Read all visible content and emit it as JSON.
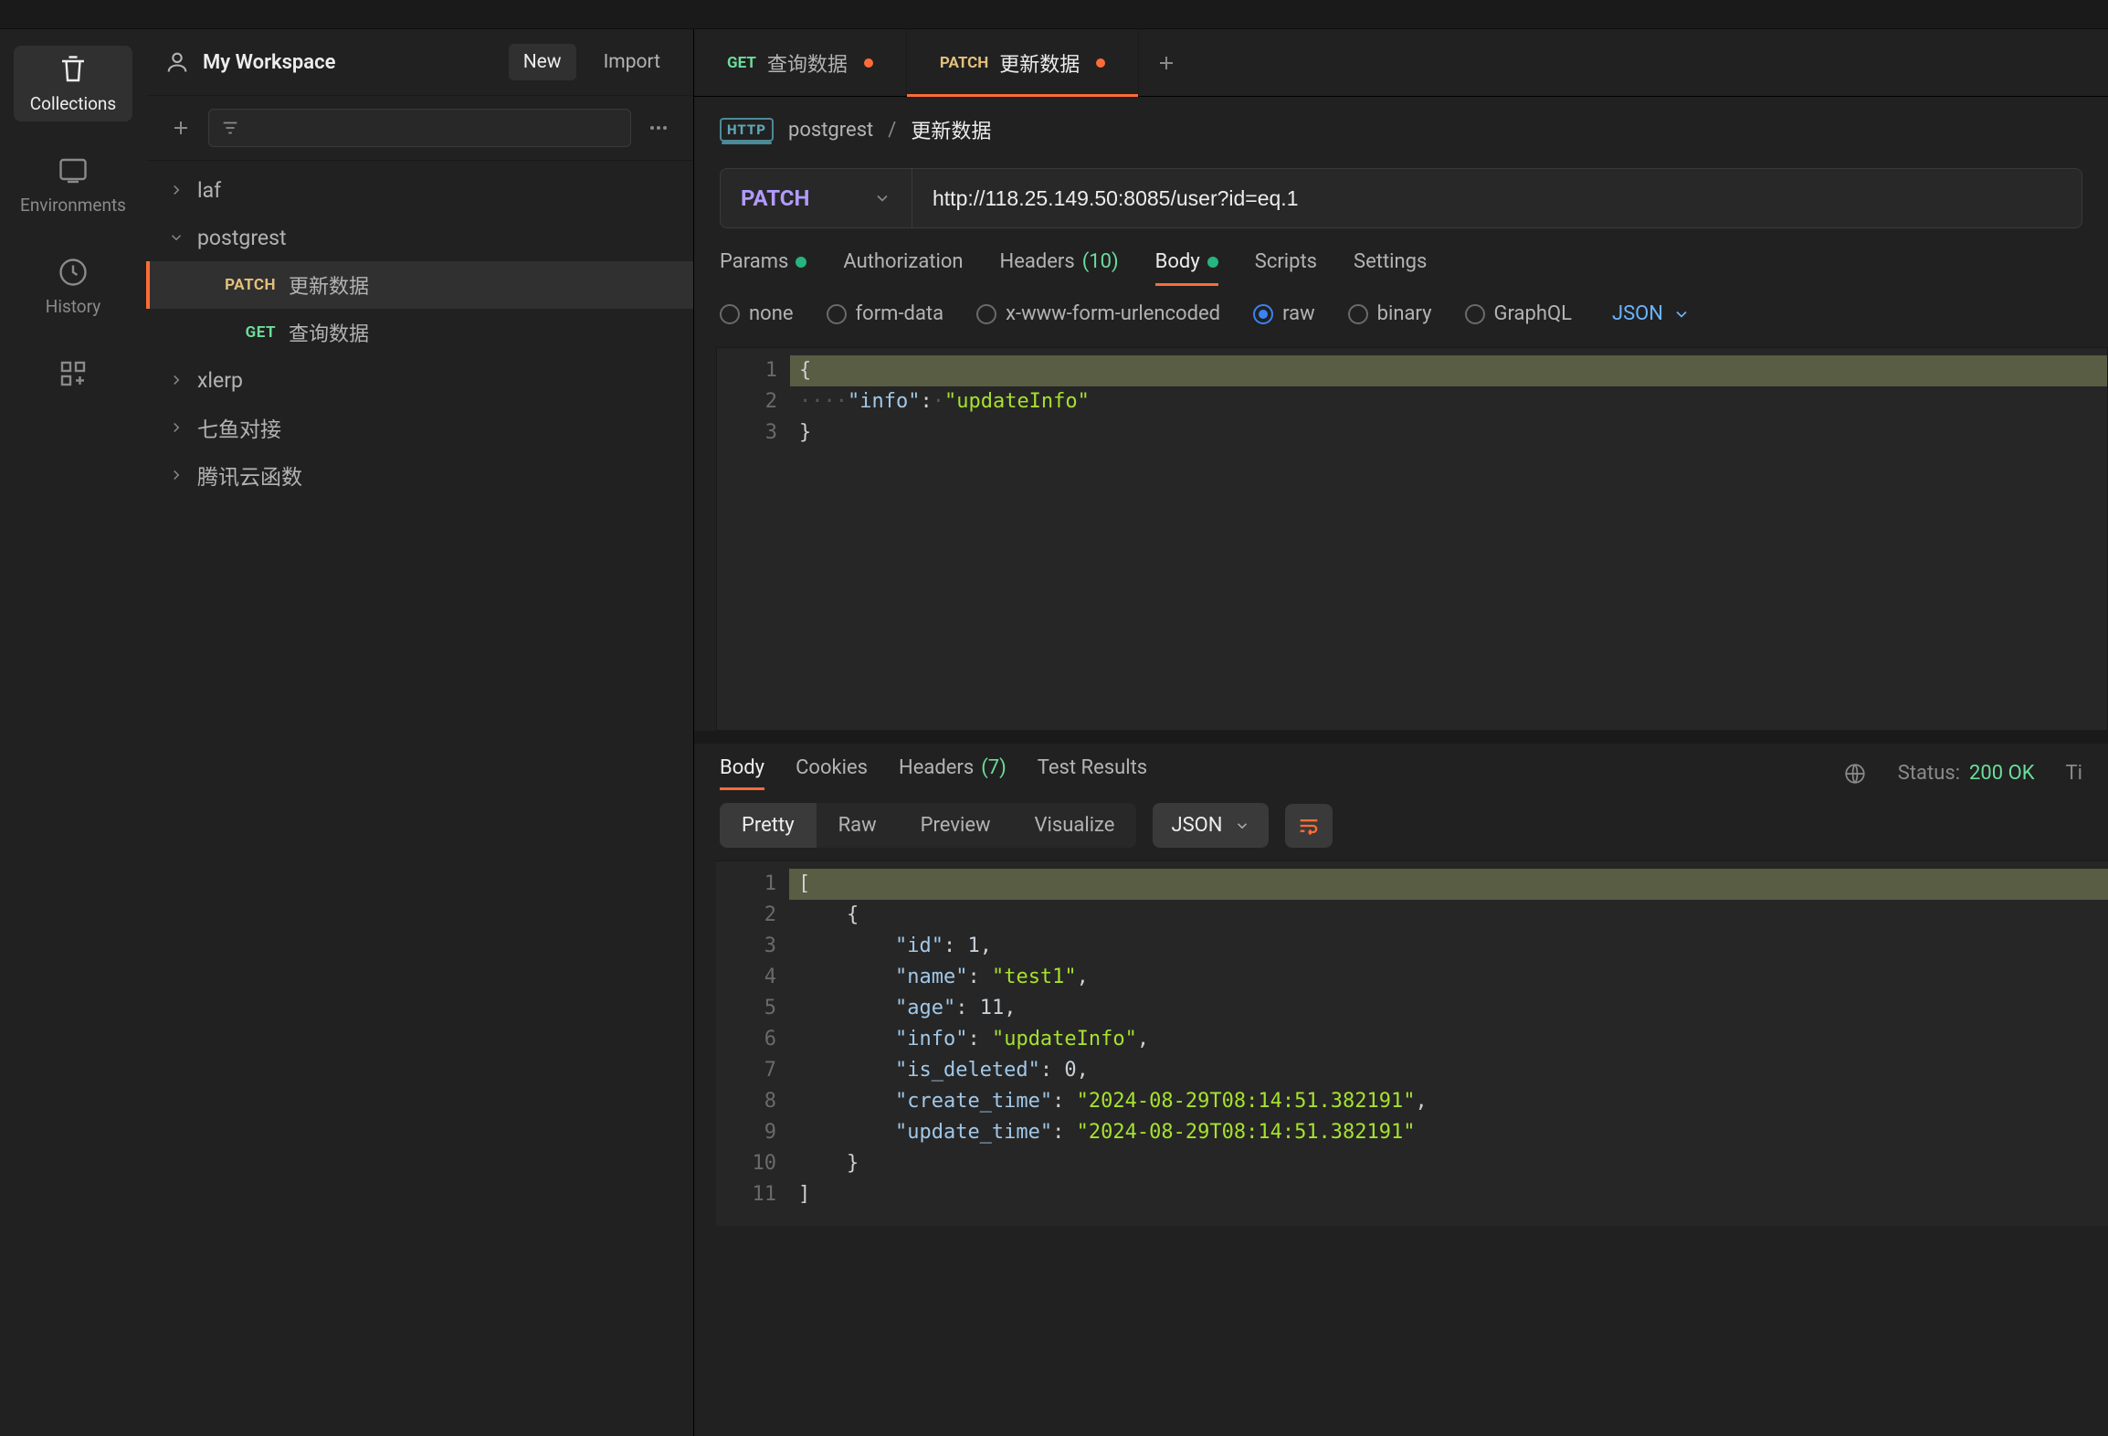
{
  "workspace": {
    "name": "My Workspace",
    "new_label": "New",
    "import_label": "Import"
  },
  "rail": {
    "collections": "Collections",
    "environments": "Environments",
    "history": "History"
  },
  "tree": {
    "items": [
      {
        "label": "laf"
      },
      {
        "label": "postgrest",
        "expanded": true,
        "children": [
          {
            "method": "PATCH",
            "label": "更新数据",
            "selected": true
          },
          {
            "method": "GET",
            "label": "查询数据"
          }
        ]
      },
      {
        "label": "xlerp"
      },
      {
        "label": "七鱼对接"
      },
      {
        "label": "腾讯云函数"
      }
    ]
  },
  "tabs": [
    {
      "method": "GET",
      "label": "查询数据",
      "dirty": true
    },
    {
      "method": "PATCH",
      "label": "更新数据",
      "dirty": true,
      "active": true
    }
  ],
  "breadcrumb": {
    "collection": "postgrest",
    "request": "更新数据"
  },
  "request": {
    "method": "PATCH",
    "url": "http://118.25.149.50:8085/user?id=eq.1",
    "tabs": {
      "params": "Params",
      "authorization": "Authorization",
      "headers": "Headers",
      "headers_count": "(10)",
      "body": "Body",
      "scripts": "Scripts",
      "settings": "Settings"
    },
    "body_types": {
      "none": "none",
      "formdata": "form-data",
      "urlenc": "x-www-form-urlencoded",
      "raw": "raw",
      "binary": "binary",
      "graphql": "GraphQL"
    },
    "lang": "JSON",
    "body_code": {
      "l1": "{",
      "l2_key": "\"info\"",
      "l2_val": "\"updateInfo\"",
      "l3": "}"
    }
  },
  "response": {
    "tabs": {
      "body": "Body",
      "cookies": "Cookies",
      "headers": "Headers",
      "headers_count": "(7)",
      "tests": "Test Results"
    },
    "status_label": "Status:",
    "status_value": "200 OK",
    "time_label": "Ti",
    "view": {
      "pretty": "Pretty",
      "raw": "Raw",
      "preview": "Preview",
      "visualize": "Visualize",
      "lang": "JSON"
    },
    "json": {
      "id": 1,
      "name": "test1",
      "age": 11,
      "info": "updateInfo",
      "is_deleted": 0,
      "create_time": "2024-08-29T08:14:51.382191",
      "update_time": "2024-08-29T08:14:51.382191"
    }
  }
}
